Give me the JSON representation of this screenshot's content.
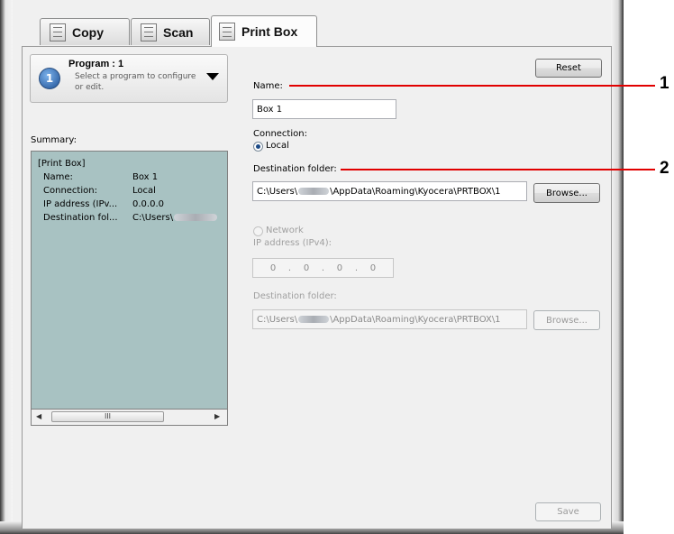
{
  "tabs": [
    {
      "label": "Copy",
      "icon": "copy-icon"
    },
    {
      "label": "Scan",
      "icon": "scan-icon"
    },
    {
      "label": "Print Box",
      "icon": "print-box-icon",
      "active": true
    }
  ],
  "program": {
    "number": "1",
    "title": "Program : 1",
    "description": "Select a program to configure or edit."
  },
  "reset_label": "Reset",
  "summary": {
    "label": "Summary:",
    "section": "[Print Box]",
    "rows": [
      {
        "key": "Name:",
        "value": "Box 1"
      },
      {
        "key": "Connection:",
        "value": "Local"
      },
      {
        "key": "IP address (IPv...",
        "value": "0.0.0.0"
      },
      {
        "key": "Destination fol...",
        "value": "C:\\Users\\"
      }
    ],
    "scroll_grip": "III"
  },
  "name_field": {
    "label": "Name:",
    "value": "Box 1"
  },
  "connection": {
    "label": "Connection:",
    "local_label": "Local",
    "local_selected": true,
    "network_label": "Network",
    "network_selected": false
  },
  "local_dest": {
    "label": "Destination folder:",
    "path_prefix": "C:\\Users\\",
    "path_suffix": "\\AppData\\Roaming\\Kyocera\\PRTBOX\\1",
    "browse_label": "Browse..."
  },
  "network": {
    "ip_label": "IP address (IPv4):",
    "ip_octets": [
      "0",
      "0",
      "0",
      "0"
    ],
    "dest_label": "Destination folder:",
    "path_prefix": "C:\\Users\\",
    "path_suffix": "\\AppData\\Roaming\\Kyocera\\PRTBOX\\1",
    "browse_label": "Browse..."
  },
  "save_label": "Save",
  "callouts": [
    "1",
    "2"
  ],
  "colors": {
    "callout_line": "#e10000",
    "summary_bg": "#a8c2c2"
  }
}
